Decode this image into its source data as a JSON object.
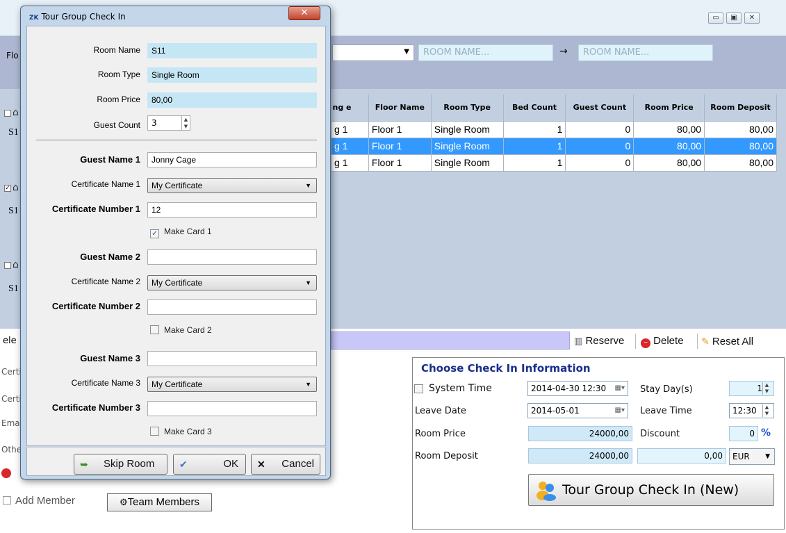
{
  "main_window": {
    "controls": [
      "▭",
      "▣",
      "✕"
    ],
    "filter": {
      "edge_label": "Flo",
      "from_placeholder": "ROOM NAME...",
      "arrow": "→",
      "to_placeholder": "ROOM NAME..."
    },
    "rooms_sliver": [
      {
        "label": "S1",
        "checked": false
      },
      {
        "label": "S1",
        "checked": true
      },
      {
        "label": "S1",
        "checked": false
      }
    ],
    "table": {
      "headers": [
        "ng e",
        "Floor Name",
        "Room Type",
        "Bed Count",
        "Guest Count",
        "Room Price",
        "Room Deposit"
      ],
      "rows": [
        [
          "g 1",
          "Floor 1",
          "Single Room",
          "1",
          "0",
          "80,00",
          "80,00"
        ],
        [
          "g 1",
          "Floor 1",
          "Single Room",
          "1",
          "0",
          "80,00",
          "80,00"
        ],
        [
          "g 1",
          "Floor 1",
          "Single Room",
          "1",
          "0",
          "80,00",
          "80,00"
        ]
      ],
      "selected_row": 1
    },
    "action_bar": {
      "select_edge": "ele",
      "reserve": "Reserve",
      "delete": "Delete",
      "reset_all": "Reset All"
    },
    "lower_edge_labels": [
      "Certi",
      "Certi",
      "Emai",
      "Othe"
    ],
    "add_member": "Add Member",
    "team_members": "Team Members"
  },
  "checkin": {
    "title": "Choose Check In Information",
    "system_time_label": "System Time",
    "system_time_value": "2014-04-30 12:30",
    "stay_days_label": "Stay Day(s)",
    "stay_days_value": "1",
    "leave_date_label": "Leave Date",
    "leave_date_value": "2014-05-01",
    "leave_time_label": "Leave Time",
    "leave_time_value": "12:30",
    "room_price_label": "Room Price",
    "room_price_value": "24000,00",
    "discount_label": "Discount",
    "discount_value": "0",
    "discount_unit": "%",
    "room_deposit_label": "Room Deposit",
    "room_deposit_value": "24000,00",
    "deposit_extra_value": "0,00",
    "currency": "EUR",
    "tour_group_button": "Tour Group Check In (New)"
  },
  "dialog": {
    "logo": "ZK",
    "title": "Tour Group Check In",
    "close": "✕",
    "room_name_label": "Room Name",
    "room_name": "S11",
    "room_type_label": "Room Type",
    "room_type": "Single Room",
    "room_price_label": "Room Price",
    "room_price": "80,00",
    "guest_count_label": "Guest Count",
    "guest_count": "3",
    "guests": [
      {
        "name_label": "Guest Name 1",
        "name": "Jonny Cage",
        "cert_name_label": "Certificate Name 1",
        "cert_name": "My Certificate",
        "cert_number_label": "Certificate Number 1",
        "cert_number": "12",
        "make_card_label": "Make Card 1",
        "make_card": true
      },
      {
        "name_label": "Guest Name 2",
        "name": "",
        "cert_name_label": "Certificate Name 2",
        "cert_name": "My Certificate",
        "cert_number_label": "Certificate Number 2",
        "cert_number": "",
        "make_card_label": "Make Card 2",
        "make_card": false
      },
      {
        "name_label": "Guest Name 3",
        "name": "",
        "cert_name_label": "Certificate Name 3",
        "cert_name": "My Certificate",
        "cert_number_label": "Certificate Number 3",
        "cert_number": "",
        "make_card_label": "Make Card 3",
        "make_card": false
      }
    ],
    "buttons": {
      "skip": "Skip Room",
      "ok": "OK",
      "cancel": "Cancel"
    }
  },
  "colors": {
    "selected_row": "#3399ff",
    "filter_panel": "#aeb7d1",
    "dialog_frame": "#c3d6ea",
    "readonly_field": "#c5e6f5",
    "panel_title": "#1a2f8a"
  }
}
